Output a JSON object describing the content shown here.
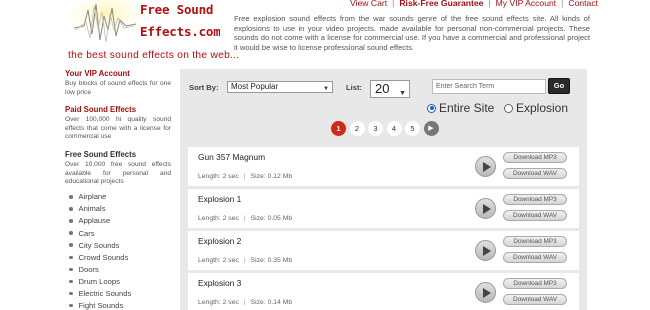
{
  "header": {
    "logo_line1": "Free Sound",
    "logo_line2": "Effects.com",
    "tagline": "the best sound effects on the web...",
    "nav": [
      {
        "label": "View Cart",
        "bold": false
      },
      {
        "label": "Risk-Free Guarantee",
        "bold": true
      },
      {
        "label": "My VIP Account",
        "bold": false
      },
      {
        "label": "Contact",
        "bold": false
      }
    ],
    "intro": "Free explosion sound effects from the war sounds genre of the free sound effects site. All kinds of explosions to use in your video projects. made available for personal non-commercial projects. These sounds do not come with a license for commercial use. If you have a commercial and professional project it would be wise to license professional sound effects."
  },
  "sidebar": {
    "vip": {
      "title": "Your VIP Account",
      "text": "Buy blocks of sound effects for one low price"
    },
    "paid": {
      "title": "Paid Sound Effects",
      "text": "Over 100,000 hi quality sound effects that come with a license for commercial use"
    },
    "free": {
      "title": "Free Sound Effects",
      "text": "Over 10,000 free sound effects available for personal and educational projects"
    },
    "categories": [
      "Airplane",
      "Animals",
      "Applause",
      "Cars",
      "City Sounds",
      "Crowd Sounds",
      "Doors",
      "Drum Loops",
      "Electric Sounds",
      "Fight Sounds"
    ]
  },
  "controls": {
    "sort_label": "Sort By:",
    "sort_value": "Most Popular",
    "list_label": "List:",
    "list_value": "20",
    "search_placeholder": "Enter Search Term",
    "go_label": "Go",
    "radio_entire": "Entire Site",
    "radio_explosion": "Explosion",
    "selected_scope": "Entire Site"
  },
  "pagination": {
    "pages": [
      "1",
      "2",
      "3",
      "4",
      "5"
    ],
    "current": "1",
    "next_symbol": "▶"
  },
  "sounds": [
    {
      "name": "Gun 357 Magnum",
      "length": "Length: 2 sec",
      "size": "Size: 0.12 Mb"
    },
    {
      "name": "Explosion 1",
      "length": "Length: 2 sec",
      "size": "Size: 0.05 Mb"
    },
    {
      "name": "Explosion 2",
      "length": "Length: 2 sec",
      "size": "Size: 0.35 Mb"
    },
    {
      "name": "Explosion 3",
      "length": "Length: 2 sec",
      "size": "Size: 0.14 Mb"
    }
  ],
  "buttons": {
    "download_mp3": "Download MP3",
    "download_wav": "Download WAV"
  },
  "colors": {
    "brand_red": "#b01010",
    "panel_bg": "#e8e8e8",
    "active_page": "#cc2a1a",
    "radio_blue": "#1a5fcc"
  },
  "icons": {
    "play": "play-icon",
    "next": "next-page-icon",
    "bullet": "bullet-icon"
  }
}
